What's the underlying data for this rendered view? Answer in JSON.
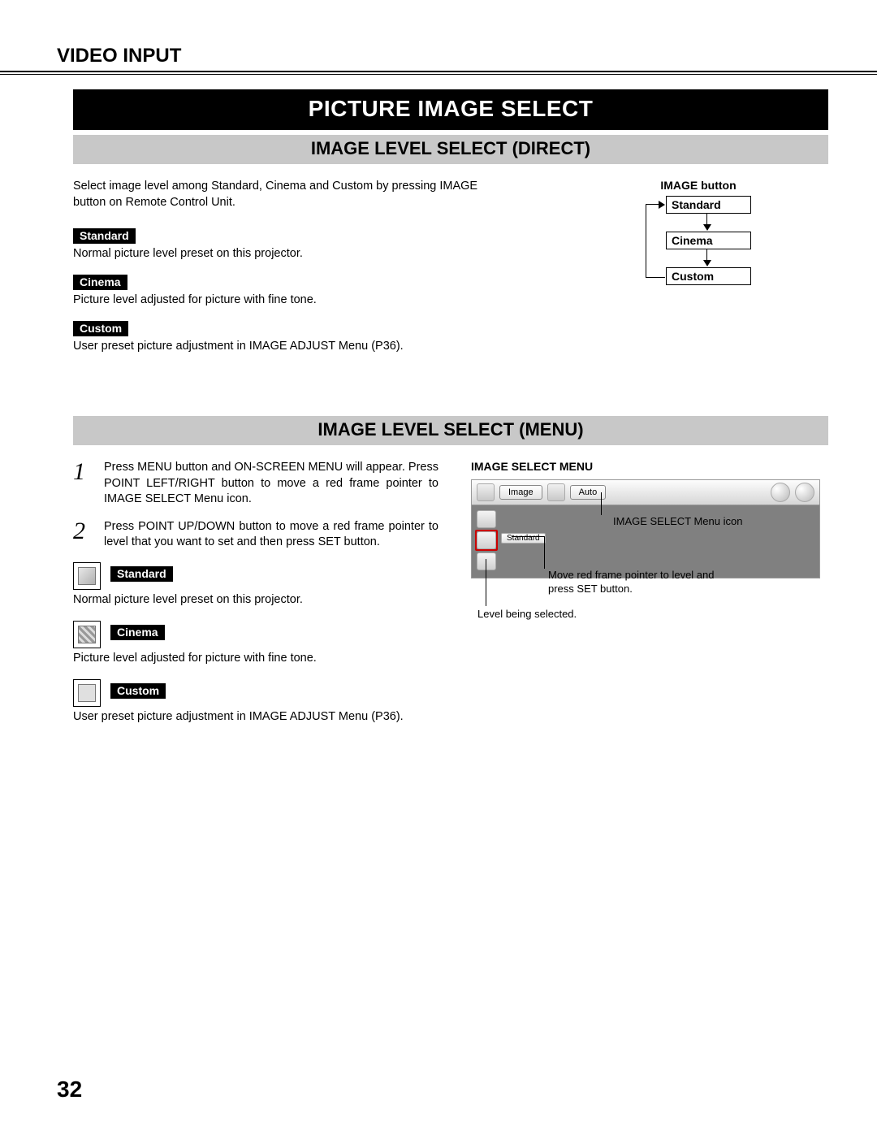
{
  "header": {
    "section": "VIDEO INPUT"
  },
  "banner": {
    "title": "PICTURE IMAGE SELECT"
  },
  "direct": {
    "heading": "IMAGE LEVEL SELECT (DIRECT)",
    "intro": "Select image level among Standard, Cinema and Custom by pressing IMAGE button on Remote Control Unit.",
    "items": {
      "standard": {
        "label": "Standard",
        "desc": "Normal picture level preset on this projector."
      },
      "cinema": {
        "label": "Cinema",
        "desc": "Picture level adjusted for picture with fine tone."
      },
      "custom": {
        "label": "Custom",
        "desc": "User preset picture adjustment in IMAGE ADJUST Menu (P36)."
      }
    },
    "diagram": {
      "title": "IMAGE button",
      "box1": "Standard",
      "box2": "Cinema",
      "box3": "Custom"
    }
  },
  "menu": {
    "heading": "IMAGE LEVEL SELECT (MENU)",
    "steps": {
      "s1": {
        "num": "1",
        "text": "Press MENU button and ON-SCREEN MENU will appear.  Press POINT LEFT/RIGHT button to move a red frame pointer to IMAGE SELECT Menu icon."
      },
      "s2": {
        "num": "2",
        "text": "Press POINT UP/DOWN button to move a red frame pointer to level that you want to set and then press SET button."
      }
    },
    "items": {
      "standard": {
        "label": "Standard",
        "desc": "Normal picture level preset on this projector."
      },
      "cinema": {
        "label": "Cinema",
        "desc": "Picture level adjusted for picture with fine tone."
      },
      "custom": {
        "label": "Custom",
        "desc": "User preset picture adjustment in IMAGE ADJUST Menu (P36)."
      }
    },
    "screenshot": {
      "title": "IMAGE SELECT MENU",
      "tab_image": "Image",
      "tab_auto": "Auto",
      "mini_label": "Standard",
      "callout_icon": "IMAGE SELECT Menu icon",
      "callout_pointer": "Move red frame pointer to level and press SET button.",
      "callout_selected": "Level being selected."
    }
  },
  "page": {
    "num": "32"
  }
}
